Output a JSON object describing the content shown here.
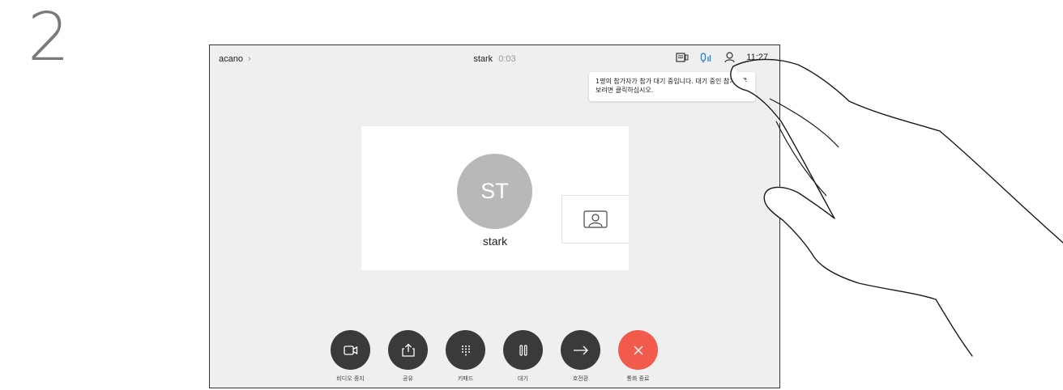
{
  "step": {
    "number": "2"
  },
  "topbar": {
    "left_label": "acano",
    "contact_name": "stark",
    "duration": "0:03",
    "time": "11:27"
  },
  "tooltip": {
    "text": "1명의 참가자가 참가 대기 중입니다. 대기 중인 참가자를 보려면 클릭하십시오."
  },
  "call": {
    "avatar_initials": "ST",
    "participant_name": "stark"
  },
  "controls": [
    {
      "label": "비디오 중지",
      "icon": "video-camera-icon"
    },
    {
      "label": "공유",
      "icon": "share-icon"
    },
    {
      "label": "키패드",
      "icon": "keypad-icon"
    },
    {
      "label": "대기",
      "icon": "pause-icon"
    },
    {
      "label": "호전환",
      "icon": "transfer-arrow-icon"
    },
    {
      "label": "통화 종료",
      "icon": "close-icon"
    }
  ],
  "colors": {
    "end_call": "#f25a4b",
    "control_button": "#3a3a3a",
    "accent_blue": "#1f7fd1"
  }
}
